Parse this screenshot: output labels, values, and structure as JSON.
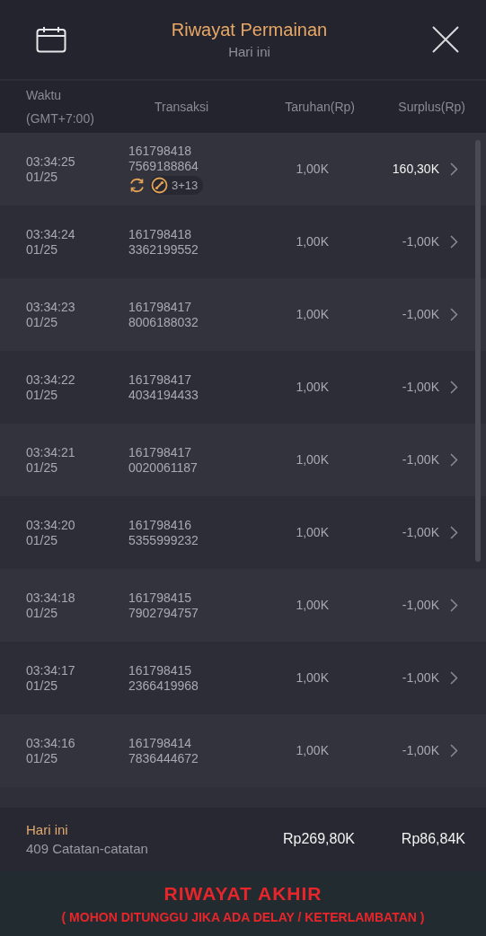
{
  "header": {
    "title": "Riwayat Permainan",
    "subtitle": "Hari ini"
  },
  "columns": [
    {
      "lines": [
        "Waktu",
        "(GMT+7:00)"
      ]
    },
    {
      "lines": [
        "Transaksi"
      ]
    },
    {
      "lines": [
        "Taruhan(Rp)"
      ]
    },
    {
      "lines": [
        "Surplus(Rp)"
      ]
    }
  ],
  "rows": [
    {
      "time": "03:34:25",
      "date": "01/25",
      "transaction": [
        "161798418",
        "7569188864"
      ],
      "bet": "1,00K",
      "surplus": "160,30K",
      "win": true,
      "extras": {
        "count": "3+13"
      }
    },
    {
      "time": "03:34:24",
      "date": "01/25",
      "transaction": [
        "161798418",
        "3362199552"
      ],
      "bet": "1,00K",
      "surplus": "-1,00K",
      "win": false
    },
    {
      "time": "03:34:23",
      "date": "01/25",
      "transaction": [
        "161798417",
        "8006188032"
      ],
      "bet": "1,00K",
      "surplus": "-1,00K",
      "win": false
    },
    {
      "time": "03:34:22",
      "date": "01/25",
      "transaction": [
        "161798417",
        "4034194433"
      ],
      "bet": "1,00K",
      "surplus": "-1,00K",
      "win": false
    },
    {
      "time": "03:34:21",
      "date": "01/25",
      "transaction": [
        "161798417",
        "0020061187"
      ],
      "bet": "1,00K",
      "surplus": "-1,00K",
      "win": false
    },
    {
      "time": "03:34:20",
      "date": "01/25",
      "transaction": [
        "161798416",
        "5355999232"
      ],
      "bet": "1,00K",
      "surplus": "-1,00K",
      "win": false
    },
    {
      "time": "03:34:18",
      "date": "01/25",
      "transaction": [
        "161798415",
        "7902794757"
      ],
      "bet": "1,00K",
      "surplus": "-1,00K",
      "win": false
    },
    {
      "time": "03:34:17",
      "date": "01/25",
      "transaction": [
        "161798415",
        "2366419968"
      ],
      "bet": "1,00K",
      "surplus": "-1,00K",
      "win": false
    },
    {
      "time": "03:34:16",
      "date": "01/25",
      "transaction": [
        "161798414",
        "7836444672"
      ],
      "bet": "1,00K",
      "surplus": "-1,00K",
      "win": false
    }
  ],
  "summary": {
    "period": "Hari ini",
    "records": "409 Catatan-catatan",
    "total_bet": "Rp269,80K",
    "total_surplus": "Rp86,84K"
  },
  "banner": {
    "title": "RIWAYAT AKHIR",
    "note": "( MOHON DITUNGGU JIKA ADA DELAY / KETERLAMBATAN )"
  }
}
